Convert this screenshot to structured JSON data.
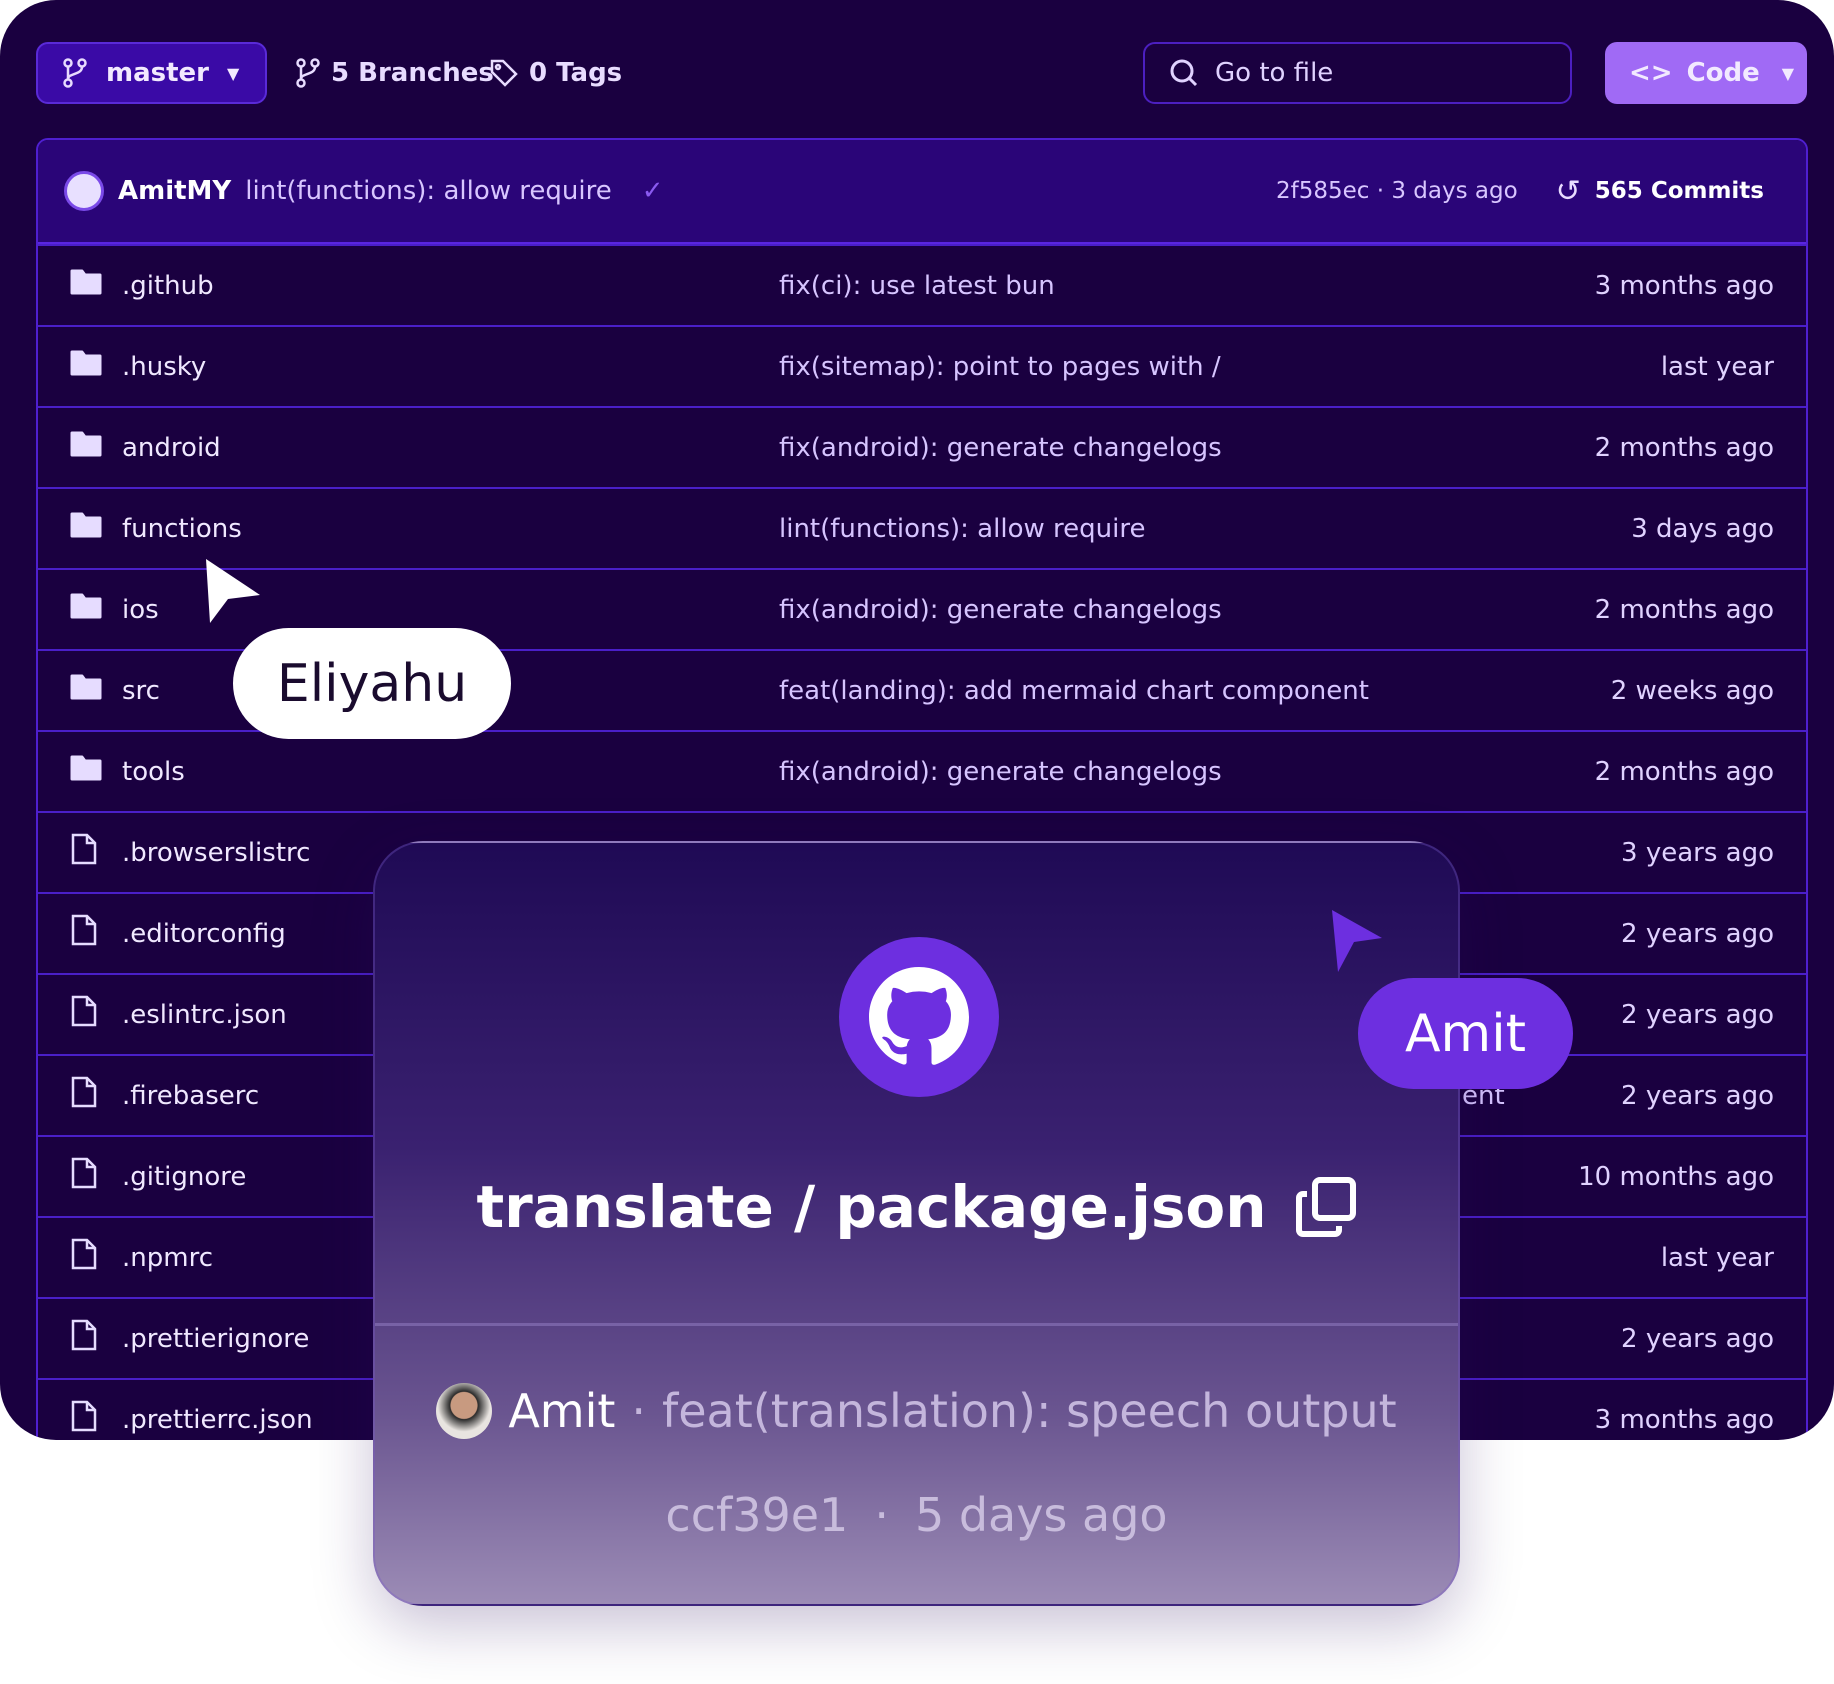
{
  "toolbar": {
    "branch": "master",
    "branches": "5 Branches",
    "tags": "0 Tags",
    "search_placeholder": "Go to file",
    "code": "Code"
  },
  "latest_commit": {
    "author": "AmitMY",
    "message": "lint(functions): allow require",
    "hash_time": "2f585ec · 3 days ago",
    "commits": "565 Commits"
  },
  "rows": [
    {
      "type": "folder",
      "name": ".github",
      "message": "fix(ci): use latest bun",
      "time": "3 months ago"
    },
    {
      "type": "folder",
      "name": ".husky",
      "message": "fix(sitemap): point to pages with /",
      "time": "last year"
    },
    {
      "type": "folder",
      "name": "android",
      "message": "fix(android): generate changelogs",
      "time": "2 months ago"
    },
    {
      "type": "folder",
      "name": "functions",
      "message": "lint(functions): allow require",
      "time": "3 days ago"
    },
    {
      "type": "folder",
      "name": "ios",
      "message": "fix(android): generate changelogs",
      "time": "2 months ago"
    },
    {
      "type": "folder",
      "name": "src",
      "message": "feat(landing): add mermaid chart component",
      "time": "2 weeks ago"
    },
    {
      "type": "folder",
      "name": "tools",
      "message": "fix(android): generate changelogs",
      "time": "2 months ago"
    },
    {
      "type": "file",
      "name": ".browserslistrc",
      "message": "",
      "time": "3 years ago"
    },
    {
      "type": "file",
      "name": ".editorconfig",
      "message": "",
      "time": "2 years ago"
    },
    {
      "type": "file",
      "name": ".eslintrc.json",
      "message": "",
      "time": "2 years ago"
    },
    {
      "type": "file",
      "name": ".firebaserc",
      "message": "ent",
      "time": "2 years ago"
    },
    {
      "type": "file",
      "name": ".gitignore",
      "message": "",
      "time": "10 months ago"
    },
    {
      "type": "file",
      "name": ".npmrc",
      "message": "",
      "time": "last year"
    },
    {
      "type": "file",
      "name": ".prettierignore",
      "message": "",
      "time": "2 years ago"
    },
    {
      "type": "file",
      "name": ".prettierrc.json",
      "message": "",
      "time": "3 months ago"
    }
  ],
  "card": {
    "title": "translate / package.json",
    "author": "Amit",
    "message": "feat(translation): speech output",
    "hash": "ccf39e1",
    "time": "5 days ago"
  },
  "cursors": {
    "eliyahu": "Eliyahu",
    "amit": "Amit"
  },
  "colors": {
    "background": "#1a0040",
    "accent": "#6d2fe0",
    "code_button": "#a06af5"
  }
}
